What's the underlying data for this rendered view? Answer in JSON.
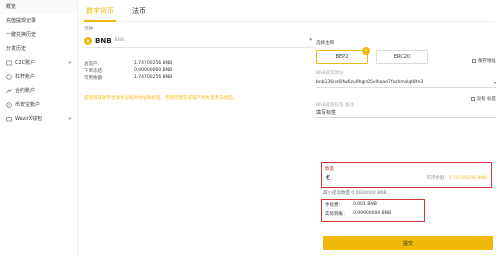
{
  "sidebar": {
    "items": [
      {
        "label": "概览",
        "icon": "none"
      },
      {
        "label": "充值提现记录",
        "icon": "none"
      },
      {
        "label": "一键兑换历史",
        "icon": "none"
      },
      {
        "label": "分发历史",
        "icon": "none"
      },
      {
        "label": "C2C账户",
        "icon": "c2c-icon"
      },
      {
        "label": "杠杆账户",
        "icon": "margin-icon"
      },
      {
        "label": "合约账户",
        "icon": "futures-icon"
      },
      {
        "label": "币安宝账户",
        "icon": "savings-icon"
      },
      {
        "label": "WazirX钱包",
        "icon": "wallet-icon"
      }
    ]
  },
  "tabs": [
    {
      "label": "数字货币"
    },
    {
      "label": "法币"
    }
  ],
  "coin": {
    "section_label": "币种",
    "symbol": "BNB",
    "sub": "BNB"
  },
  "balances": [
    {
      "k": "总资产:",
      "v": "1.74700256 BNB"
    },
    {
      "k": "下单冻结:",
      "v": "0.00000000 BNB"
    },
    {
      "k": "可用余额:",
      "v": "1.74700256 BNB"
    }
  ],
  "notice": "提现到其他平台请务必核对地址和标签，否则可能造成资产损失且无法找回。",
  "panel": {
    "network_label": "选择主网",
    "networks": [
      {
        "label": "BEP2",
        "selected": true
      },
      {
        "label": "ERC20",
        "selected": false
      }
    ],
    "address_label": "BNB提现地址",
    "address_value": "bnb136ns6lfw6zu9hgn05vlhaad7fxzhmslqt8tn3",
    "save_address": "保存地址",
    "tag_label": "BNB提现标签 备注",
    "tag_value": "填写标签",
    "no_tag": "没有 标签",
    "amount_label": "数量",
    "amount_currency": "€",
    "available_text": "可用余额：",
    "available_value": "1.74700256 BNB",
    "min_amount": "最小提现数量 0.0020000 BNB",
    "fee_label": "手续费：",
    "fee_value": "0.001 BNB",
    "receive_label": "实际到账：",
    "receive_value": "0.99900000 BNB",
    "submit_label": "提交"
  },
  "colors": {
    "accent": "#f0b90b",
    "highlight": "#d4343b"
  }
}
